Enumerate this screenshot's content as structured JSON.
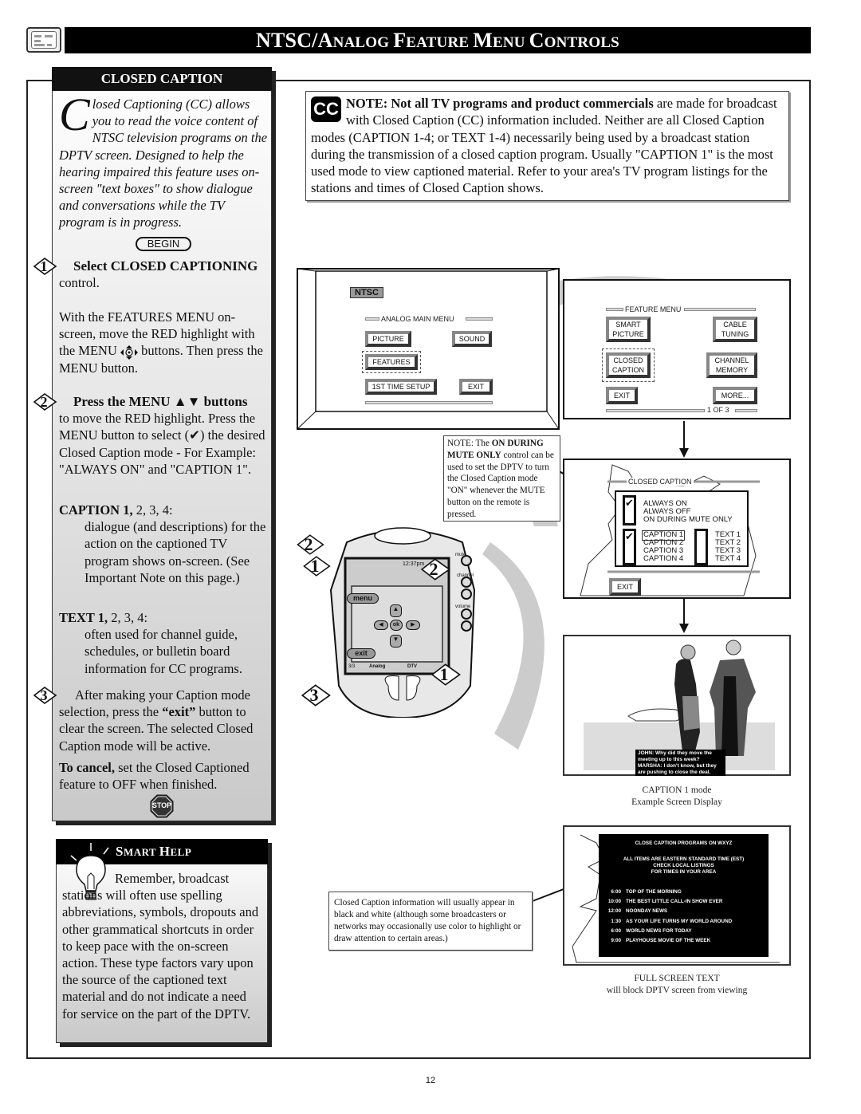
{
  "header": {
    "title_parts": [
      "NTSC/A",
      "NALOG ",
      "F",
      "EATURE ",
      "M",
      "ENU ",
      "C",
      "ONTROLS"
    ],
    "icon": "tv-menu-icon"
  },
  "closed_caption_panel": {
    "tab_label": "CLOSED CAPTION",
    "intro_dropcap": "C",
    "intro_text": "losed Captioning (CC) allows you to read the voice content of NTSC television programs on the DPTV screen. Designed to help the hearing impaired this feature uses on-screen \"text boxes\" to show dialogue and conversations while the TV program is in progress.",
    "begin_label": "BEGIN",
    "step1": {
      "number": "1",
      "heading": "Select CLOSED CAPTIONING",
      "heading_tail": "control.",
      "body_before_icon": "With the FEATURES MENU on-screen, move the RED highlight with the MENU",
      "body_after_icon": "buttons. Then press the MENU button."
    },
    "step2": {
      "number": "2",
      "heading": "Press the MENU ▲▼ buttons",
      "body_before_check": "to move the RED highlight. Press the MENU button to select (",
      "check_glyph": "✔",
      "body_after_check": ") the desired Closed Caption mode - For Example: \"ALWAYS ON\" and \"CAPTION 1\"."
    },
    "caption_def": {
      "term_bold": "CAPTION 1,",
      "term_rest": " 2, 3, 4:",
      "desc": "dialogue (and descriptions) for the action on the captioned TV program shows on-screen. (See Important Note on this page.)"
    },
    "text_def": {
      "term_bold": "TEXT 1,",
      "term_rest": " 2, 3, 4:",
      "desc": "often used for channel guide, schedules, or bulletin board information for CC programs."
    },
    "step3": {
      "number": "3",
      "text_before": "After making your Caption mode selection, press the ",
      "text_bold": "“exit”",
      "text_after": " button to clear the screen. The selected Closed Caption mode will be active."
    },
    "cancel": {
      "bold": "To cancel,",
      "rest": " set the Closed Captioned feature to OFF when finished."
    },
    "stop_label": "STOP"
  },
  "note_box": {
    "logo": "CC",
    "bold": "NOTE: Not all TV programs and product commercials",
    "rest": " are made for broadcast with Closed Caption (CC) information included. Neither are all Closed Caption modes (CAPTION 1-4; or TEXT 1-4) necessarily being used by a broadcast station during the transmission of a closed caption program. Usually \"CAPTION 1\" is the most used mode to view captioned material. Refer to your area's TV program listings for the stations and times of Closed Caption shows."
  },
  "analog_main_menu": {
    "badge": "NTSC",
    "title": "ANALOG MAIN MENU",
    "buttons": [
      "PICTURE",
      "SOUND",
      "FEATURES",
      "1ST TIME SETUP",
      "EXIT"
    ],
    "highlighted": "FEATURES"
  },
  "feature_menu": {
    "title": "FEATURE MENU",
    "buttons": [
      "SMART PICTURE",
      "CABLE TUNING",
      "CLOSED CAPTION",
      "CHANNEL MEMORY",
      "EXIT",
      "MORE..."
    ],
    "highlighted": "CLOSED CAPTION",
    "page": "1 OF 3"
  },
  "closed_caption_menu": {
    "title": "CLOSED CAPTION",
    "mode_options": [
      "ALWAYS ON",
      "ALWAYS OFF",
      "ON DURING MUTE ONLY"
    ],
    "mode_selected": "ALWAYS ON",
    "caption_options": [
      "CAPTION 1",
      "CAPTION 2",
      "CAPTION 3",
      "CAPTION 4"
    ],
    "caption_selected": "CAPTION 1",
    "text_options": [
      "TEXT 1",
      "TEXT 2",
      "TEXT 3",
      "TEXT 4"
    ],
    "check_glyph": "✔",
    "exit_label": "EXIT"
  },
  "mute_note": {
    "prefix": "NOTE: The ",
    "bold": "ON DURING MUTE ONLY",
    "rest": " control can be used to set the DPTV to turn the Closed Caption mode \"ON\" whenever the MUTE button on the remote is pressed."
  },
  "remote": {
    "time": "12:37pm",
    "menu_label": "menu",
    "ok_label": "ok",
    "exit_label": "exit",
    "mute_label": "mute",
    "channel_label": "channel",
    "volume_label": "volume",
    "page_label": "3/3",
    "analog_label": "Analog",
    "dtv_label": "DTV",
    "step_markers": [
      "2",
      "1",
      "2",
      "1",
      "3"
    ]
  },
  "caption_example": {
    "overlay_lines": [
      "JOHN: Why did they move  the",
      "meeting up to this week?",
      "MARSHA: I don't know, but they",
      "are pushing to close the deal."
    ],
    "label_line1": "CAPTION 1 mode",
    "label_line2": "Example Screen Display"
  },
  "bw_note": {
    "text": "Closed Caption information will usually appear in black and white (although some broadcasters or networks may occasionally use color to highlight or draw attention to certain areas.)"
  },
  "full_screen_text": {
    "heading": "CLOSE CAPTION PROGRAMS ON WXYZ",
    "sub_lines": [
      "ALL ITEMS ARE EASTERN STANDARD TIME (EST)",
      "CHECK LOCAL LISTINGS",
      "FOR TIMES IN YOUR AREA"
    ],
    "listings": [
      {
        "time": "6:00",
        "program": "TOP OF THE MORNING"
      },
      {
        "time": "10:00",
        "program": "THE BEST LITTLE CALL-IN SHOW EVER"
      },
      {
        "time": "12:00",
        "program": "NOONDAY NEWS"
      },
      {
        "time": "1:30",
        "program": "AS YOUR LIFE TURNS MY WORLD AROUND"
      },
      {
        "time": "6:00",
        "program": "WORLD NEWS FOR TODAY"
      },
      {
        "time": "9:00",
        "program": "PLAYHOUSE MOVIE OF THE WEEK"
      }
    ],
    "label_line1": "FULL SCREEN TEXT",
    "label_line2": "will block DPTV screen from viewing"
  },
  "smart_help": {
    "title_big1": "S",
    "title_small1": "MART ",
    "title_big2": "H",
    "title_small2": "ELP",
    "text": "Remember, broadcast stations will often use spelling abbreviations, symbols, dropouts and other grammatical shortcuts in order to keep pace with the on-screen action. These type factors vary upon the source of the captioned text material and do not indicate a need for service on the part of the DPTV."
  },
  "page_number": "12"
}
